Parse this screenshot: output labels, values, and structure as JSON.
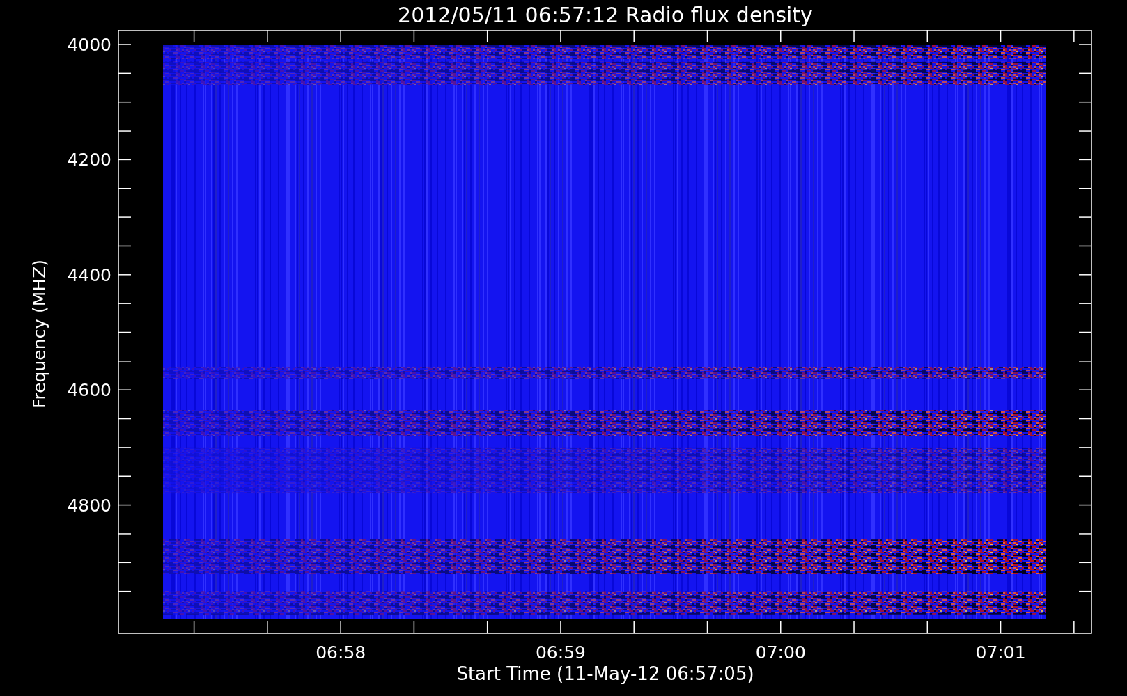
{
  "title": "2012/05/11 06:57:12 Radio flux density",
  "plot": {
    "ylabel": "Frequency (MHZ)",
    "yticks": [
      "4000",
      "4200",
      "4400",
      "4600",
      "4800"
    ],
    "xticks": [
      "06:58",
      "06:59",
      "07:00",
      "07:01"
    ],
    "xlabel": "Start Time (11-May-12 06:57:05)"
  }
}
